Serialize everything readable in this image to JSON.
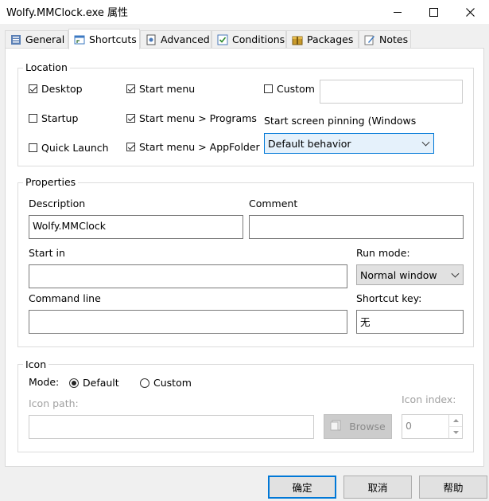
{
  "window": {
    "title": "Wolfy.MMClock.exe 属性",
    "minimize_icon": "minimize-icon",
    "maximize_icon": "maximize-icon",
    "close_icon": "close-icon"
  },
  "tabs": [
    {
      "label": "General",
      "icon": "general-tab-icon"
    },
    {
      "label": "Shortcuts",
      "icon": "shortcuts-tab-icon",
      "active": true
    },
    {
      "label": "Advanced",
      "icon": "advanced-tab-icon"
    },
    {
      "label": "Conditions",
      "icon": "conditions-tab-icon"
    },
    {
      "label": "Packages",
      "icon": "packages-tab-icon"
    },
    {
      "label": "Notes",
      "icon": "notes-tab-icon"
    }
  ],
  "location": {
    "legend": "Location",
    "desktop": {
      "label": "Desktop",
      "checked": true
    },
    "start_menu": {
      "label": "Start menu",
      "checked": true
    },
    "custom": {
      "label": "Custom",
      "checked": false,
      "value": ""
    },
    "startup": {
      "label": "Startup",
      "checked": false
    },
    "start_menu_programs": {
      "label": "Start menu > Programs",
      "checked": true
    },
    "pinning_label": "Start screen pinning (Windows",
    "quick_launch": {
      "label": "Quick Launch",
      "checked": false
    },
    "start_menu_appfolder": {
      "label": "Start menu > AppFolder",
      "checked": true
    },
    "pinning_value": "Default behavior"
  },
  "properties": {
    "legend": "Properties",
    "description_label": "Description",
    "description_value": "Wolfy.MMClock",
    "comment_label": "Comment",
    "comment_value": "",
    "start_in_label": "Start in",
    "start_in_value": "",
    "run_mode_label": "Run mode:",
    "run_mode_value": "Normal window",
    "command_line_label": "Command line",
    "command_line_value": "",
    "shortcut_key_label": "Shortcut key:",
    "shortcut_key_value": "无"
  },
  "icon": {
    "legend": "Icon",
    "mode_label": "Mode:",
    "default_label": "Default",
    "custom_label": "Custom",
    "selected": "Default",
    "icon_path_label": "Icon path:",
    "icon_path_value": "",
    "browse_label": "Browse",
    "icon_index_label": "Icon index:",
    "icon_index_value": "0"
  },
  "footer": {
    "ok": "确定",
    "cancel": "取消",
    "help": "帮助"
  },
  "colors": {
    "accent": "#0078d7",
    "combo_bg": "#e5f1fb"
  }
}
